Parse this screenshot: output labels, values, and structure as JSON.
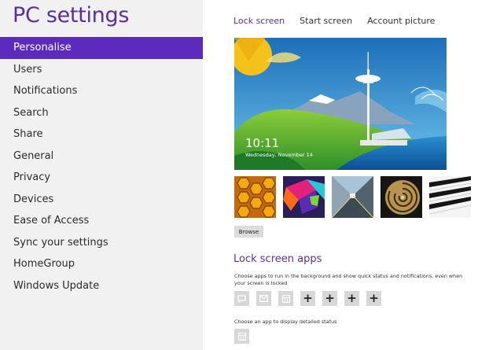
{
  "left": {
    "title": "PC settings",
    "nav": [
      "Personalise",
      "Users",
      "Notifications",
      "Search",
      "Share",
      "General",
      "Privacy",
      "Devices",
      "Ease of Access",
      "Sync your settings",
      "HomeGroup",
      "Windows Update"
    ],
    "selected": "Personalise"
  },
  "right": {
    "tabs": [
      "Lock screen",
      "Start screen",
      "Account picture"
    ],
    "active_tab": "Lock screen",
    "preview": {
      "time": "10:11",
      "date": "Wednesday, November 14"
    },
    "thumbnails": [
      "honeycomb-thumbnail",
      "abstract-cubes-thumbnail",
      "tunnel-thumbnail",
      "nautilus-shell-thumbnail",
      "piano-keys-thumbnail"
    ],
    "browse_label": "Browse",
    "lock_apps": {
      "title": "Lock screen apps",
      "description": "Choose apps to run in the background and show quick status and notifications, even when your screen is locked",
      "slots": [
        {
          "icon": "messaging-icon",
          "label": ""
        },
        {
          "icon": "mail-icon",
          "label": ""
        },
        {
          "icon": "calendar-icon",
          "label": ""
        },
        {
          "icon": "add-icon",
          "label": "+"
        },
        {
          "icon": "add-icon",
          "label": "+"
        },
        {
          "icon": "add-icon",
          "label": "+"
        },
        {
          "icon": "add-icon",
          "label": "+"
        }
      ],
      "detailed_label": "Choose an app to display detailed status",
      "detailed_icon": "calendar-icon"
    }
  },
  "colors": {
    "accent": "#5c2bbd",
    "title_purple": "#5b2fa0",
    "left_bg": "#f1f1f1"
  }
}
